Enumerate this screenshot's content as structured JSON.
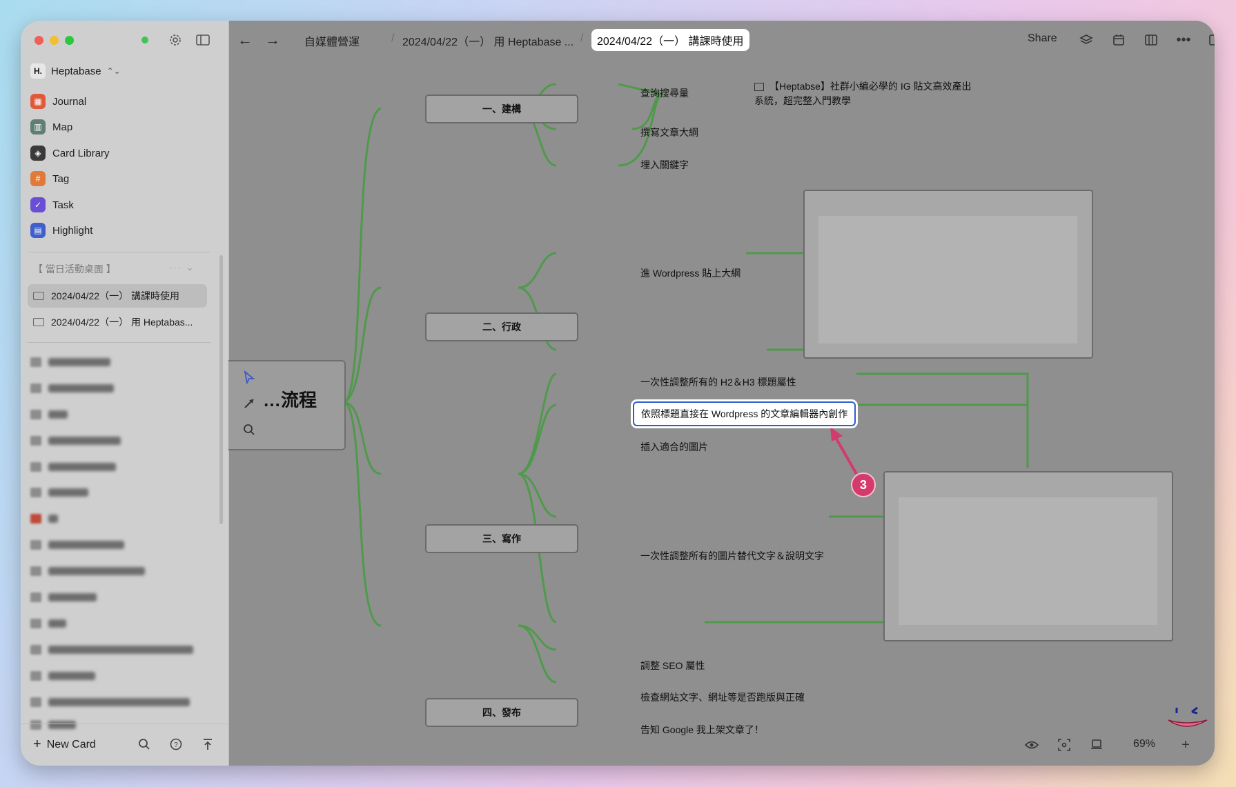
{
  "sidebar": {
    "workspace_name": "Heptabase",
    "nav_items": [
      {
        "label": "Journal",
        "icon": "calendar-icon",
        "color": "#e05a3a"
      },
      {
        "label": "Map",
        "icon": "map-icon",
        "color": "#5f7f74"
      },
      {
        "label": "Card Library",
        "icon": "layers-icon",
        "color": "#3a3a3a"
      },
      {
        "label": "Tag",
        "icon": "hashtag-icon",
        "color": "#e07a3a"
      },
      {
        "label": "Task",
        "icon": "check-circle-icon",
        "color": "#6a4fd6"
      },
      {
        "label": "Highlight",
        "icon": "highlight-icon",
        "color": "#3f5fc9"
      }
    ],
    "section_title": "【 當日活動桌面 】",
    "whiteboards": [
      {
        "label": "2024/04/22（一） 講課時使用",
        "active": true
      },
      {
        "label": "2024/04/22（一） 用 Heptabas...",
        "active": false
      }
    ],
    "new_card_label": "New Card"
  },
  "topbar": {
    "crumbs": [
      "自媒體營運",
      "2024/04/22（一） 用 Heptabase ..."
    ],
    "active_crumb": "2024/04/22（一） 講課時使用",
    "share_label": "Share"
  },
  "canvas": {
    "center_title": "…流程",
    "branches": [
      {
        "label": "一、建構"
      },
      {
        "label": "二、行政"
      },
      {
        "label": "三、寫作"
      },
      {
        "label": "四、發布"
      }
    ],
    "leaves": {
      "b1": [
        "查詢搜尋量",
        "撰寫文章大綱",
        "埋入關鍵字"
      ],
      "b2": [
        "進 Wordpress 貼上大綱",
        "一次性調整所有的 H2＆H3 標題屬性"
      ],
      "b3_highlight": "依照標題直接在 Wordpress 的文章編輯器內創作",
      "b3": [
        "插入適合的圖片",
        "一次性調整所有的圖片替代文字＆說明文字",
        "調整 SEO 屬性"
      ],
      "b4": [
        "檢查網站文字、網址等是否跑版與正確",
        "告知 Google 我上架文章了！"
      ]
    },
    "note_card": "【Heptabse】社群小編必學的 IG 貼文高效產出系統，超完整入門教學",
    "callout_number": "3"
  },
  "zoom": {
    "level": "69%"
  },
  "colors": {
    "accent": "#2d5dcf",
    "callout": "#d43a6c",
    "line": "#4f9a4a"
  }
}
